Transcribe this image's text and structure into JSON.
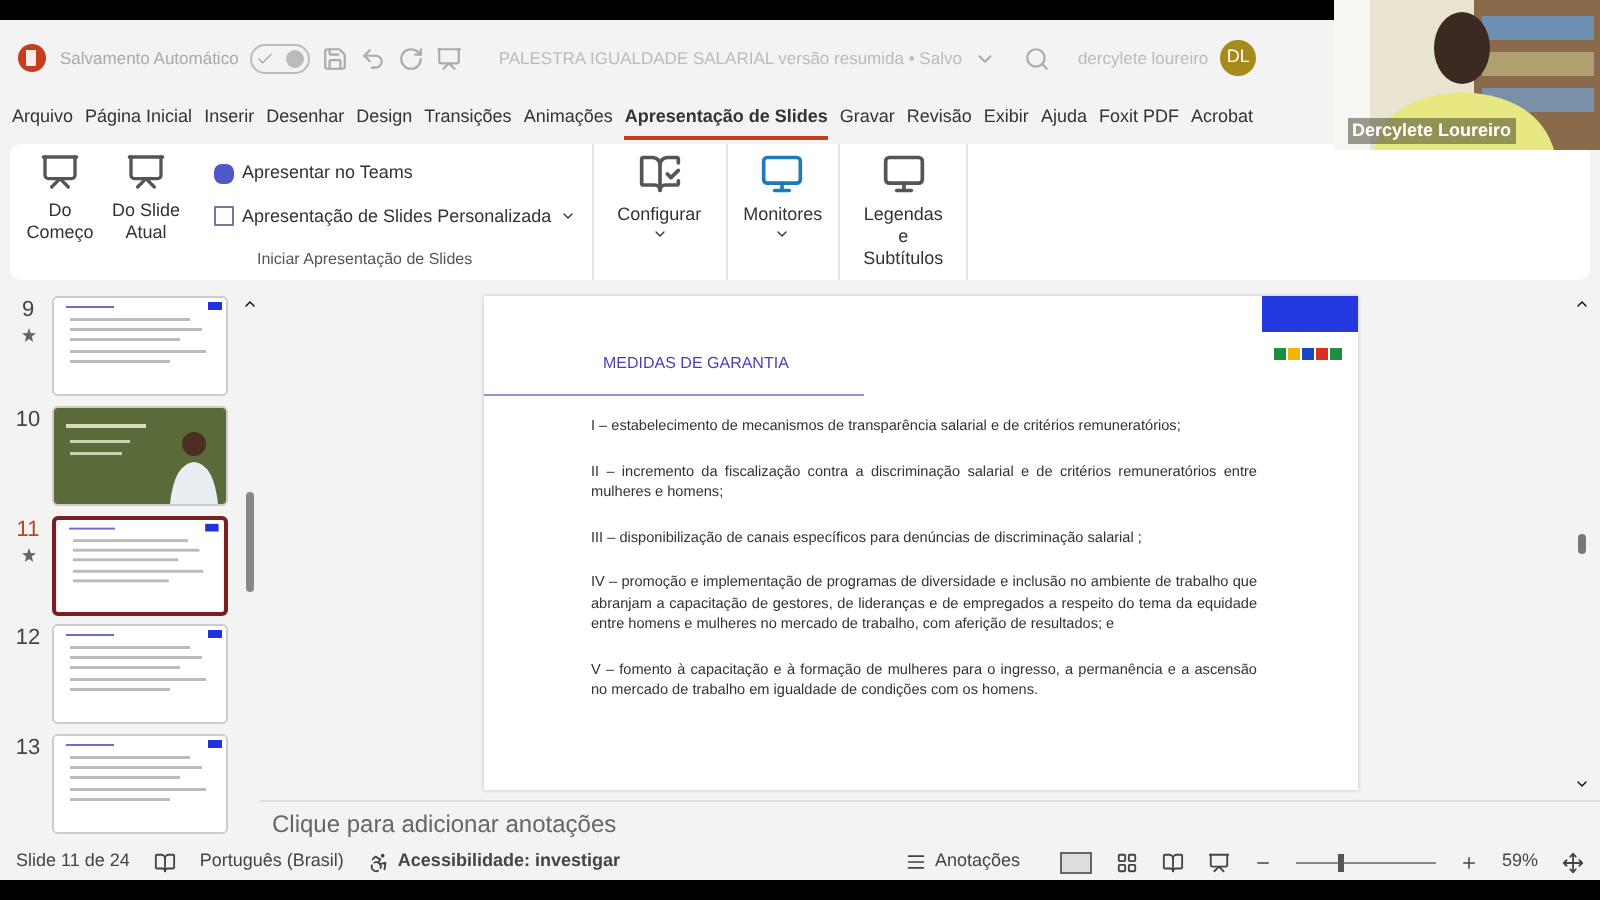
{
  "title_bar": {
    "autosave_label": "Salvamento Automático",
    "autosave_on": true,
    "document_title": "PALESTRA IGUALDADE SALARIAL versão resumida • Salvo",
    "user_name": "dercylete loureiro",
    "user_initials": "DL"
  },
  "menu_tabs": [
    {
      "label": "Arquivo",
      "selected": false
    },
    {
      "label": "Página Inicial",
      "selected": false
    },
    {
      "label": "Inserir",
      "selected": false
    },
    {
      "label": "Desenhar",
      "selected": false
    },
    {
      "label": "Design",
      "selected": false
    },
    {
      "label": "Transições",
      "selected": false
    },
    {
      "label": "Animações",
      "selected": false
    },
    {
      "label": "Apresentação de Slides",
      "selected": true
    },
    {
      "label": "Gravar",
      "selected": false
    },
    {
      "label": "Revisão",
      "selected": false
    },
    {
      "label": "Exibir",
      "selected": false
    },
    {
      "label": "Ajuda",
      "selected": false
    },
    {
      "label": "Foxit PDF",
      "selected": false
    },
    {
      "label": "Acrobat",
      "selected": false
    }
  ],
  "ribbon": {
    "start_group": {
      "label": "Iniciar Apresentação de Slides",
      "from_start": "Do Começo",
      "from_current": "Do Slide Atual",
      "teams": "Apresentar no Teams",
      "custom": "Apresentação de Slides Personalizada"
    },
    "setup": "Configurar",
    "monitors": "Monitores",
    "captions": "Legendas e Subtítulos"
  },
  "slides": [
    {
      "number": "9",
      "animated": true,
      "selected": false,
      "kind": "light"
    },
    {
      "number": "10",
      "animated": false,
      "selected": false
    },
    {
      "number": "11",
      "animated": true,
      "selected": true,
      "kind": "light"
    },
    {
      "number": "12",
      "animated": false,
      "selected": false,
      "kind": "light"
    },
    {
      "number": "13",
      "animated": false,
      "selected": false,
      "kind": "light"
    }
  ],
  "slide": {
    "title": "MEDIDAS DE GARANTIA",
    "paragraphs": [
      "I – estabelecimento de mecanismos de transparência salarial e de critérios remuneratórios;",
      "II – incremento da fiscalização contra a discriminação salarial e de critérios remuneratórios entre mulheres e homens;",
      "III – disponibilização de canais específicos para denúncias de discriminação salarial ;",
      "IV – promoção e implementação de programas de diversidade e inclusão no ambiente de trabalho que abranjam a capacitação de gestores, de lideranças e de empregados a respeito do tema da equidade entre homens e mulheres no mercado de trabalho, com aferição de resultados; e",
      "V – fomento à capacitação e à formação de mulheres para o ingresso, a permanência e a ascensão no mercado de trabalho em igualdade de condições com os homens."
    ]
  },
  "notes": {
    "placeholder": "Clique para adicionar anotações"
  },
  "status_bar": {
    "slide_info": "Slide 11 de 24",
    "language": "Português (Brasil)",
    "accessibility": "Acessibilidade: investigar",
    "notes_button": "Anotações",
    "zoom": "59%",
    "level": 0.3
  },
  "video": {
    "name": "Dercylete Loureiro"
  }
}
